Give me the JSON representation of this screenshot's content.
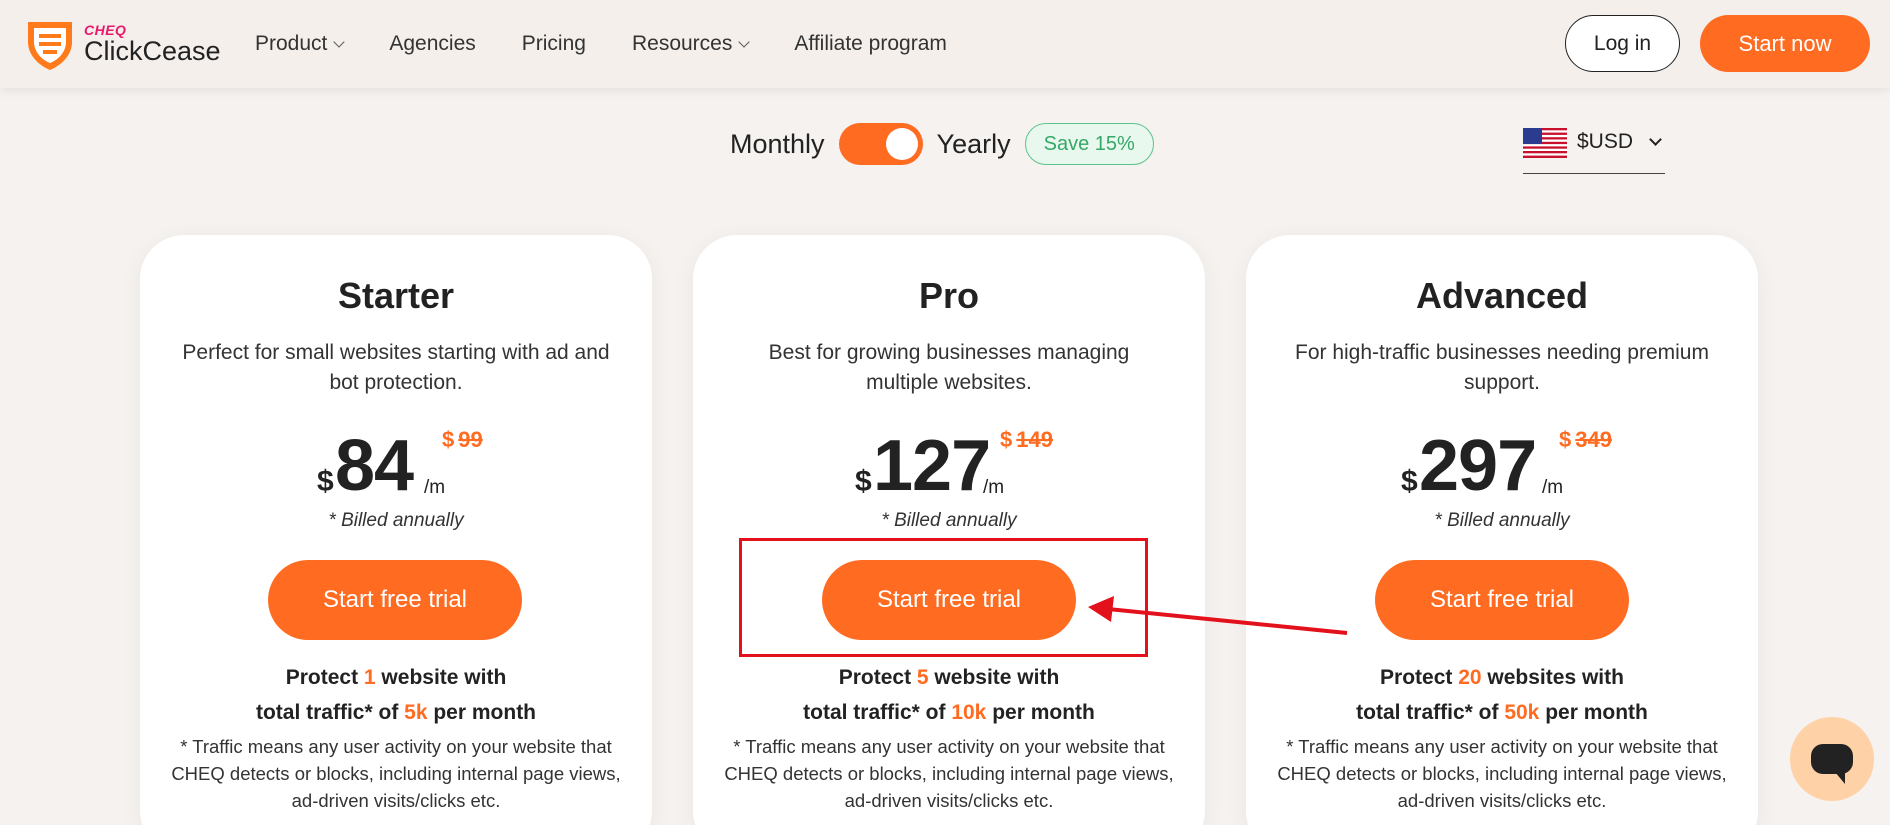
{
  "header": {
    "logo": {
      "brand": "CHEQ",
      "name": "ClickCease"
    },
    "nav": [
      {
        "label": "Product",
        "dropdown": true
      },
      {
        "label": "Agencies",
        "dropdown": false
      },
      {
        "label": "Pricing",
        "dropdown": false
      },
      {
        "label": "Resources",
        "dropdown": true
      },
      {
        "label": "Affiliate program",
        "dropdown": false
      }
    ],
    "login_label": "Log in",
    "start_label": "Start now"
  },
  "billing": {
    "monthly_label": "Monthly",
    "yearly_label": "Yearly",
    "selected": "Yearly",
    "save_badge": "Save 15%"
  },
  "currency": {
    "label": "$USD",
    "flag_icon": "us-flag-icon"
  },
  "plans": [
    {
      "title": "Starter",
      "description": "Perfect for small websites starting with ad and bot protection.",
      "currency_symbol": "$",
      "price": "84",
      "per": "/m",
      "old_currency_symbol": "$",
      "old_price": "99",
      "billed": "* Billed annually",
      "cta": "Start free trial",
      "protect_prefix": "Protect ",
      "protect_count": "1",
      "protect_suffix": " website with",
      "traffic_prefix": "total traffic* of ",
      "traffic_value": "5k",
      "traffic_suffix": " per month",
      "traffic_note": "* Traffic means any user activity on your website that CHEQ detects or blocks, including internal page views, ad-driven visits/clicks etc."
    },
    {
      "title": "Pro",
      "description": "Best for growing businesses managing multiple websites.",
      "currency_symbol": "$",
      "price": "127",
      "per": "/m",
      "old_currency_symbol": "$",
      "old_price": "149",
      "billed": "* Billed annually",
      "cta": "Start free trial",
      "protect_prefix": "Protect ",
      "protect_count": "5",
      "protect_suffix": " website with",
      "traffic_prefix": "total traffic* of ",
      "traffic_value": "10k",
      "traffic_suffix": " per month",
      "traffic_note": "* Traffic means any user activity on your website that CHEQ detects or blocks, including internal page views, ad-driven visits/clicks etc."
    },
    {
      "title": "Advanced",
      "description": "For high-traffic businesses needing premium support.",
      "currency_symbol": "$",
      "price": "297",
      "per": "/m",
      "old_currency_symbol": "$",
      "old_price": "349",
      "billed": "* Billed annually",
      "cta": "Start free trial",
      "protect_prefix": "Protect ",
      "protect_count": "20",
      "protect_suffix": " websites with",
      "traffic_prefix": "total traffic* of ",
      "traffic_value": "50k",
      "traffic_suffix": " per month",
      "traffic_note": "* Traffic means any user activity on your website that CHEQ detects or blocks, including internal page views, ad-driven visits/clicks etc."
    }
  ],
  "colors": {
    "accent": "#ff6b21",
    "brand_pink": "#e8196a",
    "save_green": "#36a866",
    "annotation_red": "#e3111b"
  },
  "chat_icon": "chat-bubble-icon"
}
